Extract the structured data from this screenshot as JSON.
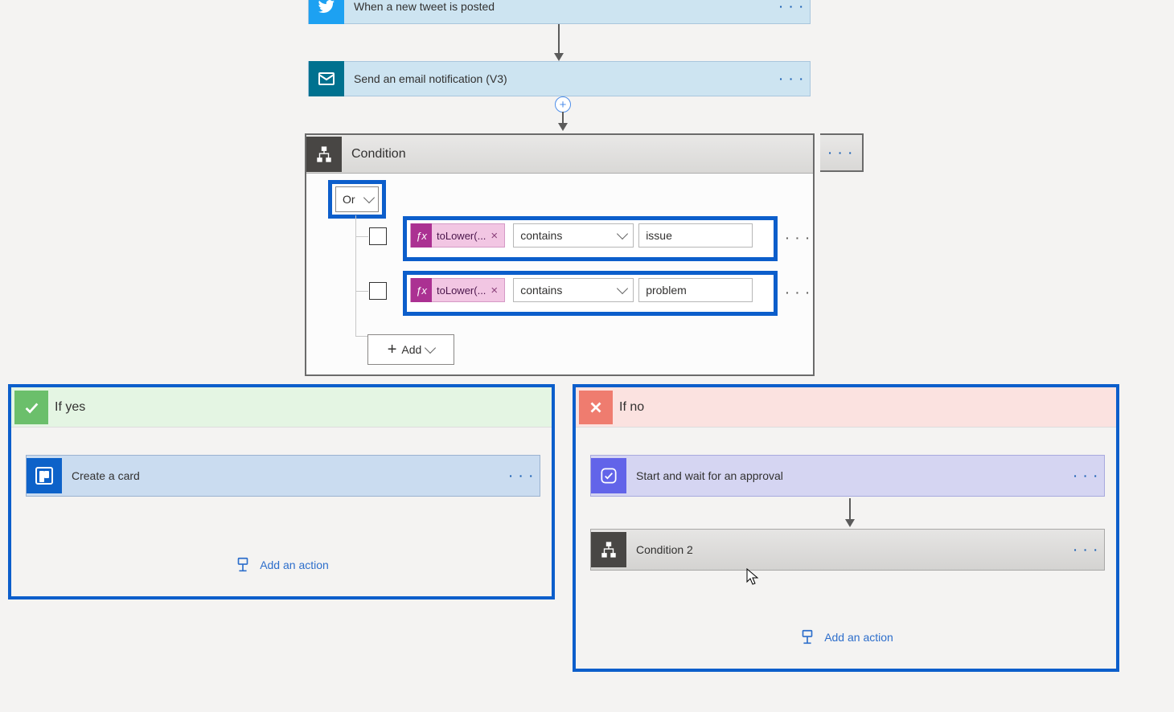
{
  "trigger": {
    "label": "When a new tweet is posted"
  },
  "email_step": {
    "label": "Send an email notification (V3)"
  },
  "condition": {
    "title": "Condition",
    "group_operator": "Or",
    "add_label": "Add",
    "rows": [
      {
        "expression": "toLower(...",
        "operator": "contains",
        "value": "issue"
      },
      {
        "expression": "toLower(...",
        "operator": "contains",
        "value": "problem"
      }
    ]
  },
  "branches": {
    "yes": {
      "title": "If yes",
      "card": {
        "label": "Create a card"
      },
      "add_action": "Add an action"
    },
    "no": {
      "title": "If no",
      "approval": {
        "label": "Start and wait for an approval"
      },
      "condition2": {
        "label": "Condition 2"
      },
      "add_action": "Add an action"
    }
  },
  "glyphs": {
    "more": "· · ·",
    "plus": "+",
    "x": "×"
  }
}
